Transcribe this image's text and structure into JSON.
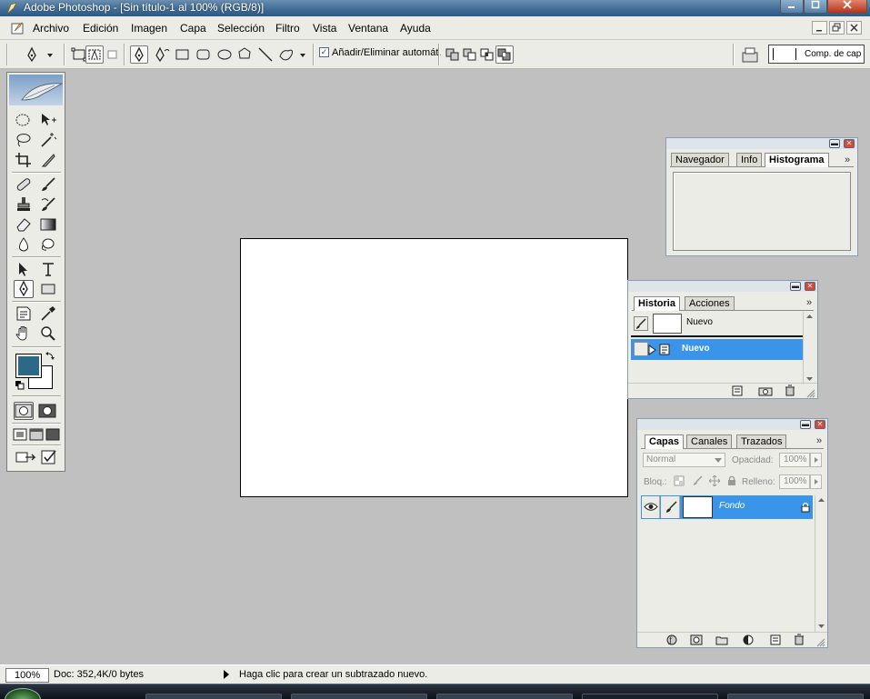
{
  "window": {
    "title": "Adobe Photoshop - [Sin título-1 al 100% (RGB/8)]",
    "controls": [
      "minimize",
      "maximize",
      "close"
    ]
  },
  "menu": {
    "items": [
      "Archivo",
      "Edición",
      "Imagen",
      "Capa",
      "Selección",
      "Filtro",
      "Vista",
      "Ventana",
      "Ayuda"
    ]
  },
  "options_bar": {
    "active_tool_icon": "pen-icon",
    "shape_tool_icons": [
      "pen-icon",
      "freeform-pen-icon",
      "rectangle-icon",
      "rounded-rectangle-icon",
      "ellipse-icon",
      "polygon-icon",
      "line-icon",
      "custom-shape-icon"
    ],
    "auto_add_delete_checked": true,
    "auto_add_delete_label": "Añadir/Eliminar automát.",
    "comp_box_label": "Comp. de cap"
  },
  "toolbox": {
    "foreground_color": "#2e6887",
    "background_color": "#ffffff"
  },
  "palettes": {
    "histogram": {
      "tabs": [
        "Navegador",
        "Info",
        "Histograma"
      ],
      "active_tab": "Histograma"
    },
    "history": {
      "tabs": [
        "Historia",
        "Acciones"
      ],
      "active_tab": "Historia",
      "rows": [
        {
          "label": "Nuevo",
          "type": "snapshot"
        },
        {
          "label": "Nuevo",
          "type": "state",
          "selected": true
        }
      ]
    },
    "layers": {
      "tabs": [
        "Capas",
        "Canales",
        "Trazados"
      ],
      "active_tab": "Capas",
      "blend_mode": "Normal",
      "opacity_label": "Opacidad:",
      "opacity_value": "100%",
      "lock_label": "Bloq.:",
      "fill_label": "Relleno:",
      "fill_value": "100%",
      "layers": [
        {
          "name": "Fondo",
          "visible": true,
          "locked": true,
          "selected": true
        }
      ]
    }
  },
  "status_bar": {
    "zoom": "100%",
    "doc_size": "Doc: 352,4K/0 bytes",
    "message": "Haga clic para crear un subtrazado nuevo."
  }
}
